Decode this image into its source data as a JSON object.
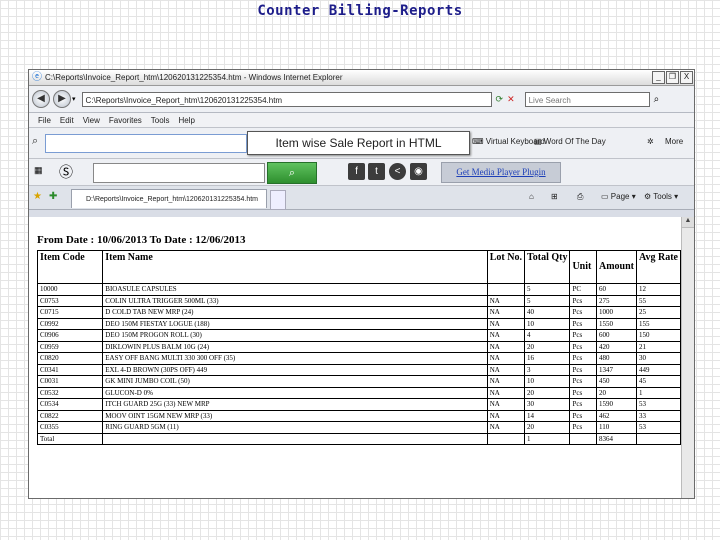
{
  "slide_title": "Counter Billing-Reports",
  "window": {
    "title": "C:\\Reports\\Invoice_Report_htm\\120620131225354.htm - Windows Internet Explorer",
    "minimize": "_",
    "restore": "❐",
    "close": "X"
  },
  "address": {
    "url": "C:\\Reports\\Invoice_Report_htm\\120620131225354.htm",
    "search_placeholder": "Live Search"
  },
  "menu": [
    "File",
    "Edit",
    "View",
    "Favorites",
    "Tools",
    "Help"
  ],
  "toolbar": {
    "callout": "Item wise Sale Report in HTML",
    "virtual_keyboard": "Virtual Keyboard",
    "word_of_day": "Word Of The Day",
    "more": "More"
  },
  "toolbar2": {
    "media_player": "Get Media Player Plugin"
  },
  "tab": {
    "title": "D:\\Reports\\Invoice_Report_htm\\120620131225354.htm",
    "page_label": "Page",
    "tools_label": "Tools"
  },
  "report": {
    "date_line": "From Date : 10/06/2013 To Date : 12/06/2013",
    "headers": [
      "Item Code",
      "Item Name",
      "Lot No.",
      "Total Qty",
      "Unit",
      "Amount",
      "Avg Rate"
    ],
    "rows": [
      [
        "10000",
        "BIOASULE CAPSULES",
        "",
        "5",
        "PC",
        "60",
        "12"
      ],
      [
        "C0753",
        "COLIN ULTRA TRIGGER 500ML (33)",
        "NA",
        "5",
        "Pcs",
        "275",
        "55"
      ],
      [
        "C0715",
        "D COLD TAB NEW MRP (24)",
        "NA",
        "40",
        "Pcs",
        "1000",
        "25"
      ],
      [
        "C0992",
        "DEO 150M FIESTAY LOGUE (188)",
        "NA",
        "10",
        "Pcs",
        "1550",
        "155"
      ],
      [
        "C0906",
        "DEO 150M PROGON ROLL (30)",
        "NA",
        "4",
        "Pcs",
        "600",
        "150"
      ],
      [
        "C0959",
        "DIKLOWIN PLUS BALM 10G (24)",
        "NA",
        "20",
        "Pcs",
        "420",
        "21"
      ],
      [
        "C0820",
        "EASY OFF BANG MULTI 330 300 OFF (35)",
        "NA",
        "16",
        "Pcs",
        "480",
        "30"
      ],
      [
        "C0341",
        "EXL 4-D BROWN (30PS OFF) 449",
        "NA",
        "3",
        "Pcs",
        "1347",
        "449"
      ],
      [
        "C0031",
        "GK MINI JUMBO COIL (50)",
        "NA",
        "10",
        "Pcs",
        "450",
        "45"
      ],
      [
        "C0532",
        "GLUCON-D 0%",
        "NA",
        "20",
        "Pcs",
        "20",
        "1"
      ],
      [
        "C0534",
        "ITCH GUARD 25G (33) NEW MRP",
        "NA",
        "30",
        "Pcs",
        "1590",
        "53"
      ],
      [
        "C0822",
        "MOOV OINT 15GM NEW MRP (33)",
        "NA",
        "14",
        "Pcs",
        "462",
        "33"
      ],
      [
        "C0355",
        "RING GUARD 5GM (11)",
        "NA",
        "20",
        "Pcs",
        "110",
        "53"
      ],
      [
        "Total",
        "",
        "",
        "1",
        "",
        "8364",
        ""
      ]
    ]
  }
}
